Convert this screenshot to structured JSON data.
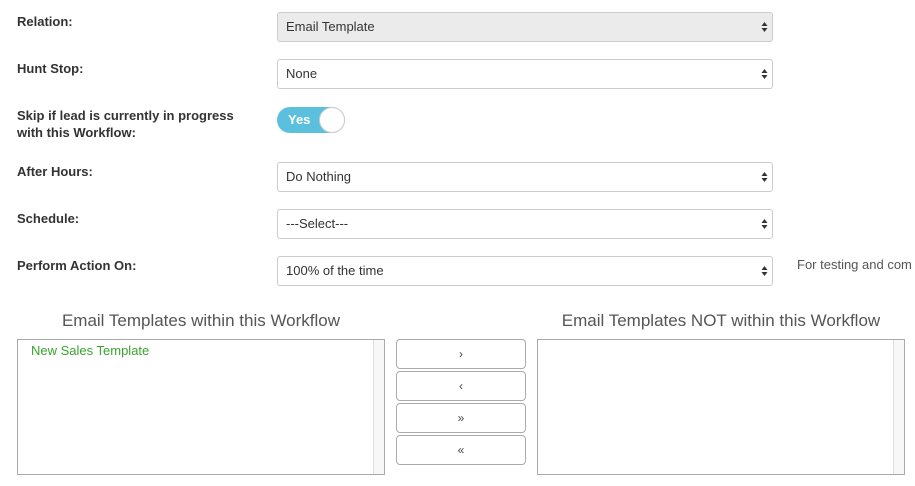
{
  "form": {
    "relation": {
      "label": "Relation:",
      "value": "Email Template"
    },
    "hunt_stop": {
      "label": "Hunt Stop:",
      "value": "None"
    },
    "skip_lead": {
      "label_line1": "Skip if lead is currently in progress",
      "label_line2": "with this Workflow:",
      "toggle_label": "Yes",
      "state": true
    },
    "after_hours": {
      "label": "After Hours:",
      "value": "Do Nothing"
    },
    "schedule": {
      "label": "Schedule:",
      "value": "---Select---"
    },
    "perform_action": {
      "label": "Perform Action On:",
      "value": "100% of the time",
      "hint": "For testing and com"
    }
  },
  "lists": {
    "within": {
      "title": "Email Templates within this Workflow",
      "items": [
        "New Sales Template"
      ]
    },
    "not_within": {
      "title": "Email Templates NOT within this Workflow",
      "items": []
    }
  },
  "move_buttons": {
    "add": "›",
    "remove": "‹",
    "add_all": "»",
    "remove_all": "«"
  },
  "colors": {
    "toggle_on": "#5bc0de",
    "list_item_text": "#3aa32f",
    "disabled_select_bg": "#ebebeb"
  },
  "icons": [
    "select-arrows-icon"
  ]
}
